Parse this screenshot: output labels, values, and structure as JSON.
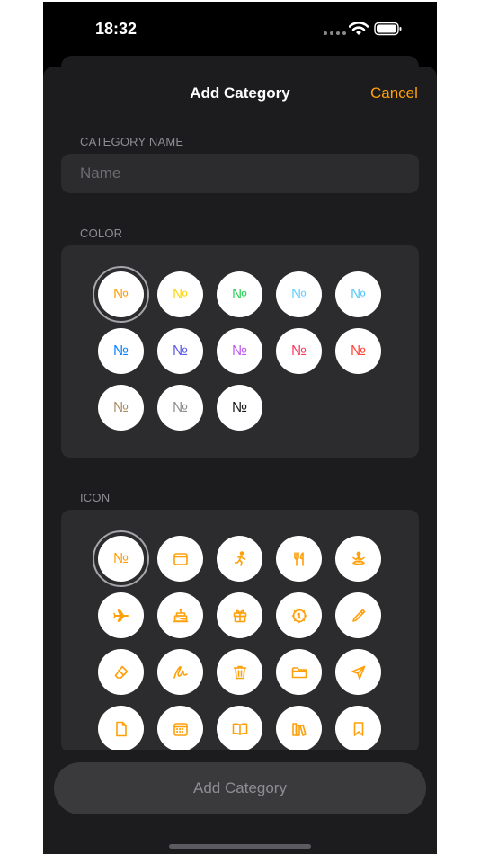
{
  "status_bar": {
    "time": "18:32"
  },
  "nav": {
    "title": "Add Category",
    "cancel_label": "Cancel"
  },
  "name_section": {
    "label": "CATEGORY NAME",
    "placeholder": "Name",
    "value": ""
  },
  "color_section": {
    "label": "COLOR",
    "glyph": "№",
    "swatches": [
      "#ff9f0a",
      "#ffd60a",
      "#30d158",
      "#64d2ff",
      "#5ac8fa",
      "#0a84ff",
      "#5e5ce6",
      "#bf5af2",
      "#ff375f",
      "#ff453a",
      "#ac8e68",
      "#8e8e93",
      "#1c1c1e"
    ],
    "selected_index": 0
  },
  "icon_section": {
    "label": "ICON",
    "glyph": "№",
    "icons": [
      "number-icon",
      "window-icon",
      "running-figure-icon",
      "fork-knife-icon",
      "meditation-icon",
      "airplane-icon",
      "birthday-cake-icon",
      "gift-icon",
      "gear-badge-icon",
      "pencil-icon",
      "eraser-icon",
      "scribble-icon",
      "trash-icon",
      "folder-icon",
      "paper-plane-icon",
      "document-icon",
      "calendar-icon",
      "book-icon",
      "books-icon",
      "bookmark-icon"
    ],
    "selected_index": 0,
    "accent": "#ff9f0a"
  },
  "footer": {
    "add_label": "Add Category"
  }
}
